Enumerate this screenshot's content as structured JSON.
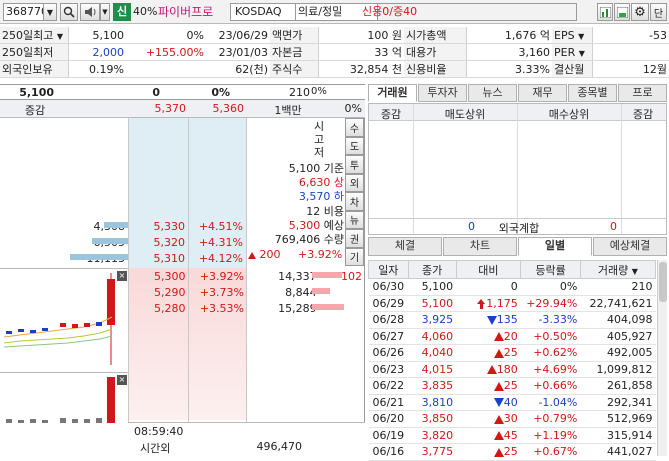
{
  "toolbar": {
    "code": "368770",
    "signal": "신",
    "ratio": "40%",
    "name": "파이버프로",
    "market": "KOSDAQ",
    "sector": "의료/정밀",
    "credit": "신용0/증40",
    "dan": "단"
  },
  "info_rows": [
    [
      "250일최고",
      "5,100",
      "0%",
      "23/06/29",
      "액면가",
      "100 원",
      "시가총액",
      "1,676 억",
      "EPS",
      "-53"
    ],
    [
      "250일최저",
      "2,000",
      "+155.00%",
      "23/01/03",
      "자본금",
      "33 억",
      "대용가",
      "3,160",
      "PER",
      ""
    ],
    [
      "외국인보유",
      "0.19%",
      "",
      "62(천)",
      "주식수",
      "32,854 천",
      "신용비율",
      "3.33%",
      "결산월",
      "12월"
    ]
  ],
  "quote": {
    "price": "5,100",
    "change": "0",
    "pct": "0%",
    "volume": "210",
    "pct2": "0%"
  },
  "orderbook": {
    "header": {
      "label": "증감",
      "ask_low": "5,370",
      "ask_high": "5,360",
      "unit": "1백만",
      "pct": "0%"
    },
    "side_tabs": [
      "시",
      "고",
      "저"
    ],
    "right_tabs": [
      "수",
      "도",
      "투",
      "외",
      "차",
      "뉴",
      "권",
      "기"
    ],
    "stats": [
      [
        "5,100",
        "기준"
      ],
      [
        "6,630",
        "상"
      ],
      [
        "3,570",
        "하"
      ],
      [
        "12",
        "비용"
      ],
      [
        "5,300",
        "예상"
      ],
      [
        "769,406",
        "수량"
      ]
    ],
    "exp_change": "200",
    "exp_pct": "+3.92%",
    "asks": [
      [
        "4,308",
        "5,330",
        "+4.51%"
      ],
      [
        "6,505",
        "5,320",
        "+4.31%"
      ],
      [
        "11,113",
        "5,310",
        "+4.12%"
      ]
    ],
    "bids": [
      [
        "5,300",
        "+3.92%",
        "14,337",
        "102"
      ],
      [
        "5,290",
        "+3.73%",
        "8,844",
        ""
      ],
      [
        "5,280",
        "+3.53%",
        "15,289",
        ""
      ]
    ],
    "time": "08:59:40",
    "time_label": "시간외",
    "bottom_total": "496,470"
  },
  "right_panel": {
    "tabs": [
      "거래원",
      "투자자",
      "뉴스",
      "재무",
      "종목별",
      "프로"
    ],
    "header": [
      "증감",
      "매도상위",
      "매수상위",
      "증감"
    ],
    "foreign": [
      "0",
      "외국계합",
      "0"
    ],
    "tabs2": [
      "체결",
      "차트",
      "일별",
      "예상체결"
    ],
    "cols": [
      "일자",
      "종가",
      "대비",
      "등락률",
      "거래량"
    ],
    "rows": [
      [
        "06/30",
        "5,100",
        "",
        "0",
        "0%",
        "210",
        "k"
      ],
      [
        "06/29",
        "5,100",
        "up",
        "1,175",
        "+29.94%",
        "22,741,621",
        "r"
      ],
      [
        "06/28",
        "3,925",
        "dn",
        "135",
        "-3.33%",
        "404,098",
        "b"
      ],
      [
        "06/27",
        "4,060",
        "tri",
        "20",
        "+0.50%",
        "405,927",
        "r"
      ],
      [
        "06/26",
        "4,040",
        "tri",
        "25",
        "+0.62%",
        "492,005",
        "r"
      ],
      [
        "06/23",
        "4,015",
        "tri",
        "180",
        "+4.69%",
        "1,099,812",
        "r"
      ],
      [
        "06/22",
        "3,835",
        "tri",
        "25",
        "+0.66%",
        "261,858",
        "r"
      ],
      [
        "06/21",
        "3,810",
        "dn",
        "40",
        "-1.04%",
        "292,341",
        "b"
      ],
      [
        "06/20",
        "3,850",
        "tri",
        "30",
        "+0.79%",
        "512,969",
        "r"
      ],
      [
        "06/19",
        "3,820",
        "tri",
        "45",
        "+1.19%",
        "315,914",
        "r"
      ],
      [
        "06/16",
        "3,775",
        "tri",
        "25",
        "+0.67%",
        "441,027",
        "r"
      ]
    ]
  },
  "colors": {
    "red": "#d01818",
    "blue": "#1a3fc9",
    "ask_bg": "#dfeef5",
    "bid_bg": "#fbe3e3"
  }
}
